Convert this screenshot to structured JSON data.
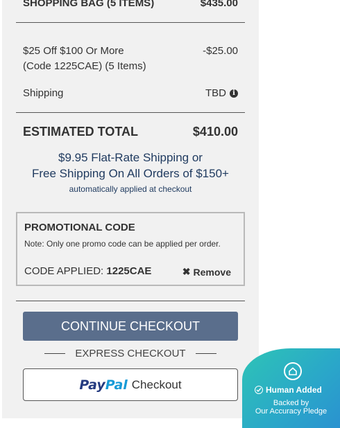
{
  "summary": {
    "bag_label": "SHOPPING BAG (5 ITEMS)",
    "bag_amount": "$435.00",
    "discount_label": "$25 Off $100 Or More (Code 1225CAE) (5 Items)",
    "discount_amount": "-$25.00",
    "shipping_label": "Shipping",
    "shipping_value": "TBD",
    "total_label": "ESTIMATED TOTAL",
    "total_amount": "$410.00"
  },
  "shipping_promo": {
    "line1": "$9.95 Flat-Rate Shipping or",
    "line2": "Free Shipping On All Orders of $150+",
    "line3": "automatically applied at checkout"
  },
  "promo_code": {
    "title": "PROMOTIONAL CODE",
    "note": "Note: Only one promo code can be applied per order.",
    "applied_label": "CODE APPLIED:",
    "applied_code": "1225CAE",
    "remove_label": "Remove"
  },
  "checkout": {
    "continue_label": "CONTINUE CHECKOUT",
    "express_label": "EXPRESS CHECKOUT",
    "paypal_pay": "Pay",
    "paypal_pal": "Pal",
    "paypal_checkout": "Checkout"
  },
  "badge": {
    "title": "Human Added",
    "sub1": "Backed by",
    "sub2": "Our Accuracy Pledge"
  },
  "colors": {
    "panel_bg": "#f1f1f1",
    "continue_bg": "#5a6e8c",
    "promo_text": "#1f3a5f",
    "paypal_dark": "#253b80",
    "paypal_light": "#179bd7",
    "badge_teal": "#2ec4b6"
  }
}
